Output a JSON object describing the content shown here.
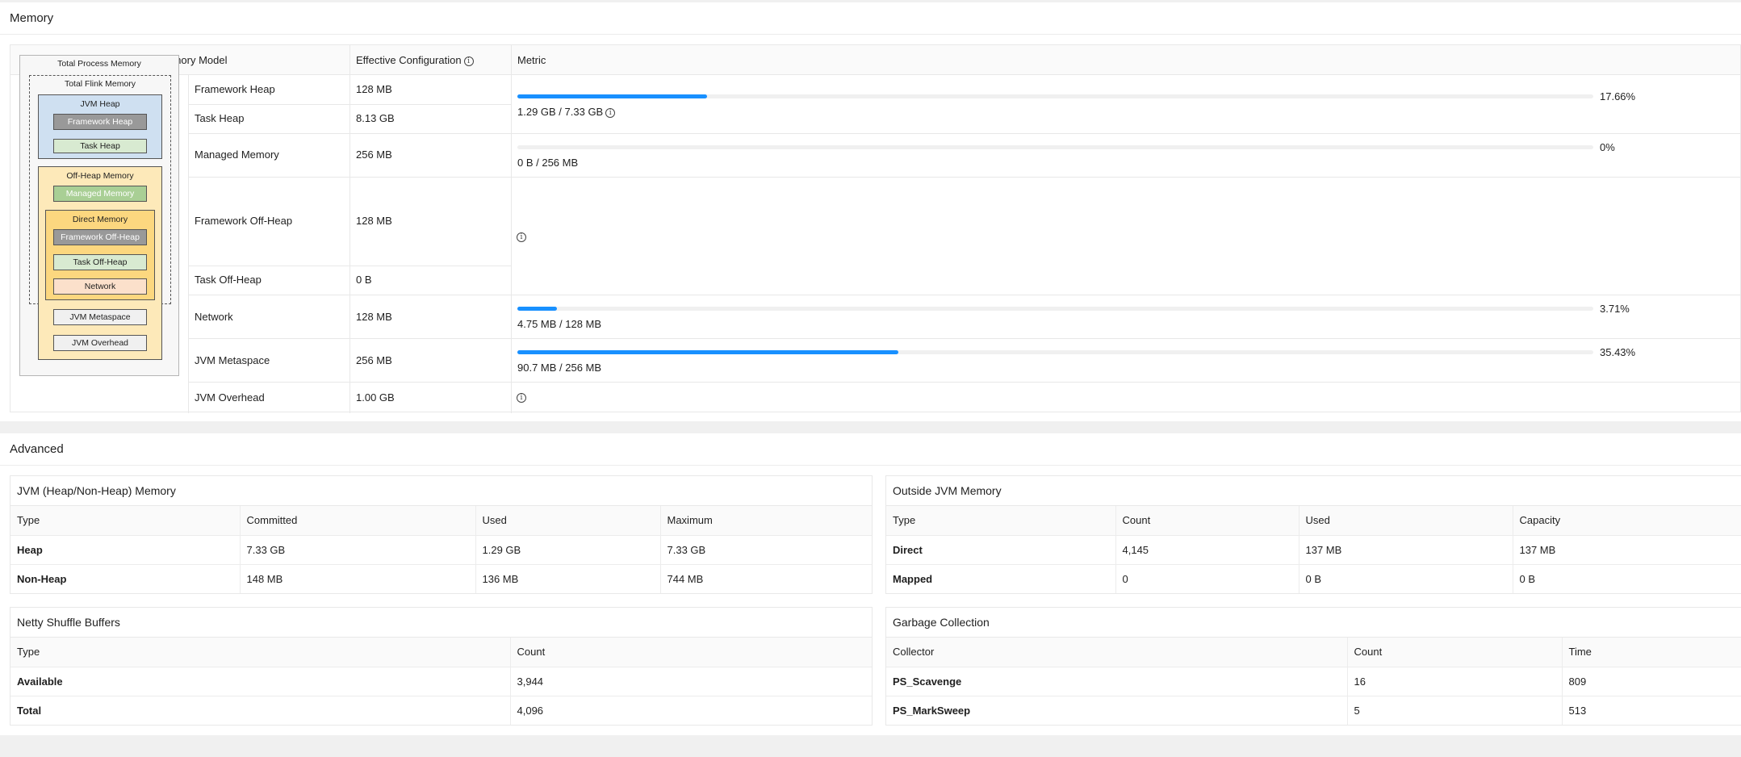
{
  "memory": {
    "title": "Memory",
    "headers": {
      "model": "Flink Memory Model",
      "config": "Effective Configuration",
      "metric": "Metric"
    },
    "rows": [
      {
        "name": "Framework Heap",
        "value": "128 MB"
      },
      {
        "name": "Task Heap",
        "value": "8.13 GB"
      },
      {
        "name": "Managed Memory",
        "value": "256 MB"
      },
      {
        "name": "Framework Off-Heap",
        "value": "128 MB"
      },
      {
        "name": "Task Off-Heap",
        "value": "0 B"
      },
      {
        "name": "Network",
        "value": "128 MB"
      },
      {
        "name": "JVM Metaspace",
        "value": "256 MB"
      },
      {
        "name": "JVM Overhead",
        "value": "1.00 GB"
      }
    ],
    "metrics": {
      "heap": {
        "percent": "17.66%",
        "fraction": 0.1766,
        "usage": "1.29 GB / 7.33 GB"
      },
      "managed": {
        "percent": "0%",
        "fraction": 0,
        "usage": "0 B / 256 MB"
      },
      "network": {
        "percent": "3.71%",
        "fraction": 0.0371,
        "usage": "4.75 MB / 128 MB"
      },
      "metaspace": {
        "percent": "35.43%",
        "fraction": 0.3543,
        "usage": "90.7 MB / 256 MB"
      }
    },
    "diagram": {
      "total_process": "Total Process Memory",
      "total_flink": "Total Flink Memory",
      "jvm_heap": "JVM Heap",
      "framework_heap": "Framework Heap",
      "task_heap": "Task Heap",
      "off_heap": "Off-Heap Memory",
      "managed_memory": "Managed Memory",
      "direct_memory": "Direct Memory",
      "framework_off_heap": "Framework Off-Heap",
      "task_off_heap": "Task Off-Heap",
      "network": "Network",
      "jvm_metaspace": "JVM Metaspace",
      "jvm_overhead": "JVM Overhead"
    },
    "colors": {
      "progress": "#1890ff",
      "jvm_heap_bg": "#cfe0f1",
      "off_heap_bg": "#fde9b9",
      "managed_bg": "#a9cf95",
      "gray_box": "#999999",
      "task_bg": "#d8ead1",
      "network_bg": "#fbe0cb"
    }
  },
  "advanced": {
    "title": "Advanced",
    "jvm": {
      "title": "JVM (Heap/Non-Heap) Memory",
      "columns": [
        "Type",
        "Committed",
        "Used",
        "Maximum"
      ],
      "rows": [
        [
          "Heap",
          "7.33 GB",
          "1.29 GB",
          "7.33 GB"
        ],
        [
          "Non-Heap",
          "148 MB",
          "136 MB",
          "744 MB"
        ]
      ]
    },
    "outside": {
      "title": "Outside JVM Memory",
      "columns": [
        "Type",
        "Count",
        "Used",
        "Capacity"
      ],
      "rows": [
        [
          "Direct",
          "4,145",
          "137 MB",
          "137 MB"
        ],
        [
          "Mapped",
          "0",
          "0 B",
          "0 B"
        ]
      ]
    },
    "netty": {
      "title": "Netty Shuffle Buffers",
      "columns": [
        "Type",
        "Count"
      ],
      "rows": [
        [
          "Available",
          "3,944"
        ],
        [
          "Total",
          "4,096"
        ]
      ]
    },
    "gc": {
      "title": "Garbage Collection",
      "columns": [
        "Collector",
        "Count",
        "Time"
      ],
      "rows": [
        [
          "PS_Scavenge",
          "16",
          "809"
        ],
        [
          "PS_MarkSweep",
          "5",
          "513"
        ]
      ]
    }
  }
}
